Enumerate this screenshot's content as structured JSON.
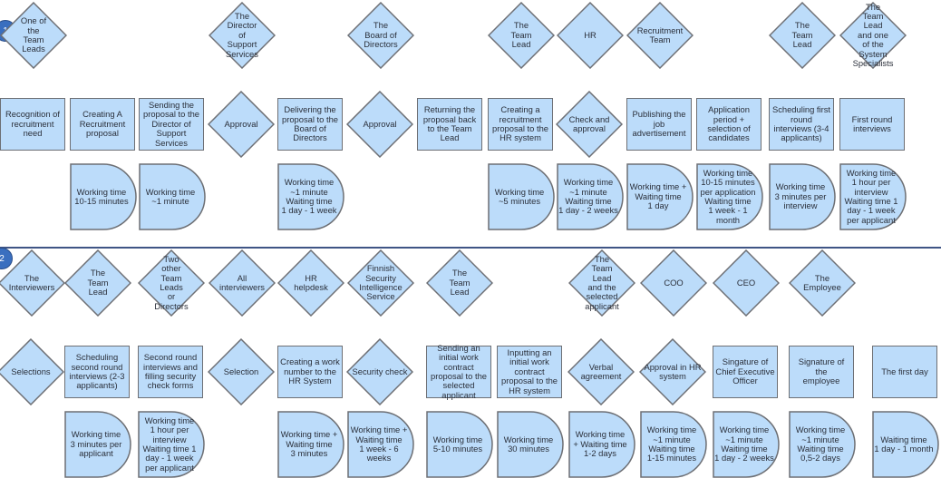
{
  "diagram": {
    "type": "swimlane-process-flow",
    "colors": {
      "shape_fill": "#bcdcfa",
      "shape_stroke": "#6d6f74",
      "divider": "#3f5585",
      "badge": "#3a6fbf"
    },
    "lanes": [
      {
        "badge": "1",
        "columns": [
          {
            "actor": "One of\nthe\nTeam\nLeads",
            "step": "Recognition of\nrecruitment\nneed",
            "step_shape": "box",
            "time": null
          },
          {
            "actor": null,
            "step": "Creating A\nRecruitment\nproposal",
            "step_shape": "box",
            "time": "Working time\n10-15 minutes"
          },
          {
            "actor": null,
            "step": "Sending the\nproposal to the\nDirector of\nSupport\nServices",
            "step_shape": "box",
            "time": "Working time\n~1 minute"
          },
          {
            "actor": "The\nDirector\nof\nSupport\nServices",
            "step": "Approval",
            "step_shape": "diamond",
            "time": null
          },
          {
            "actor": null,
            "step": "Delivering the\nproposal to the\nBoard of\nDirectors",
            "step_shape": "box",
            "time": "Working time\n~1 minute\nWaiting time\n1 day - 1 week"
          },
          {
            "actor": "The\nBoard of\nDirectors",
            "step": "Approval",
            "step_shape": "diamond",
            "time": null
          },
          {
            "actor": null,
            "step": "Returning the\nproposal back\nto the Team\nLead",
            "step_shape": "box",
            "time": null
          },
          {
            "actor": "The\nTeam\nLead",
            "step": "Creating a\nrecruitment\nproposal to the\nHR system",
            "step_shape": "box",
            "time": "Working time\n~5 minutes"
          },
          {
            "actor": "HR",
            "step": "Check and\napproval",
            "step_shape": "diamond",
            "time": "Working time\n~1 minute\nWaiting time\n1 day - 2 weeks"
          },
          {
            "actor": "Recruitment\nTeam",
            "step": "Publishing the\njob\nadvertisement",
            "step_shape": "box",
            "time": "Working time +\nWaiting time\n1 day"
          },
          {
            "actor": null,
            "step": "Application\nperiod +\nselection of\ncandidates",
            "step_shape": "box",
            "time": "Working time\n10-15 minutes\nper application\nWaiting time\n1 week - 1\nmonth"
          },
          {
            "actor": "The\nTeam\nLead",
            "step": "Scheduling first\nround\ninterviews (3-4\napplicants)",
            "step_shape": "box",
            "time": "Working time\n3 minutes per\ninterview"
          },
          {
            "actor": "The\nTeam\nLead\nand one\nof the\nSystem\nSpecialists",
            "step": "First round\ninterviews",
            "step_shape": "box",
            "time": "Working time\n1 hour per\ninterview\nWaiting time 1\nday - 1 week\nper applicant"
          }
        ]
      },
      {
        "badge": "2",
        "columns": [
          {
            "actor": "The\nInterviewers",
            "step": "Selections",
            "step_shape": "diamond",
            "time": null
          },
          {
            "actor": "The\nTeam\nLead",
            "step": "Scheduling\nsecond round\ninterviews (2-3\napplicants)",
            "step_shape": "box",
            "time": "Working time\n3 minutes per\napplicant"
          },
          {
            "actor": "Two\nother\nTeam\nLeads\nor\nDirectors",
            "step": "Second round\ninterviews and\nfilling security\ncheck forms",
            "step_shape": "box",
            "time": "Working time\n1 hour per\ninterview\nWaiting time 1\nday - 1 week\nper applicant"
          },
          {
            "actor": "All\ninterviewers",
            "step": "Selection",
            "step_shape": "diamond",
            "time": null
          },
          {
            "actor": "HR\nhelpdesk",
            "step": "Creating a work\nnumber to the\nHR System",
            "step_shape": "box",
            "time": "Working time +\nWaiting time\n3 minutes"
          },
          {
            "actor": "Finnish\nSecurity\nIntelligence\nService",
            "step": "Security check",
            "step_shape": "diamond",
            "time": "Working time +\nWaiting time\n1 week - 6\nweeks"
          },
          {
            "actor": "The\nTeam\nLead",
            "step": "Sending an\ninitial work\ncontract\nproposal to the\nselected\napplicant",
            "step_shape": "box",
            "time": "Working time\n5-10 minutes"
          },
          {
            "actor": null,
            "step": "Inputting an\ninitial work\ncontract\nproposal to the\nHR system",
            "step_shape": "box",
            "time": "Working time\n30 minutes"
          },
          {
            "actor": "The\nTeam\nLead\nand the\nselected\napplicant",
            "step": "Verbal\nagreement",
            "step_shape": "diamond",
            "time": "Working time\n+ Waiting time\n1-2 days"
          },
          {
            "actor": "COO",
            "step": "Approval in HR\nsystem",
            "step_shape": "diamond",
            "time": "Working time\n~1 minute\nWaiting time\n1-15 minutes"
          },
          {
            "actor": "CEO",
            "step": "Singature of\nChief Executive\nOfficer",
            "step_shape": "box",
            "time": "Working time\n~1 minute\nWaiting time\n1 day - 2 weeks"
          },
          {
            "actor": "The\nEmployee",
            "step": "Signature of the\nemployee",
            "step_shape": "box",
            "time": "Working time\n~1 minute\nWaiting time\n0,5-2 days"
          },
          {
            "actor": null,
            "step": "The first day",
            "step_shape": "box",
            "time": "Waiting time\n1 day - 1 month"
          }
        ]
      }
    ]
  }
}
